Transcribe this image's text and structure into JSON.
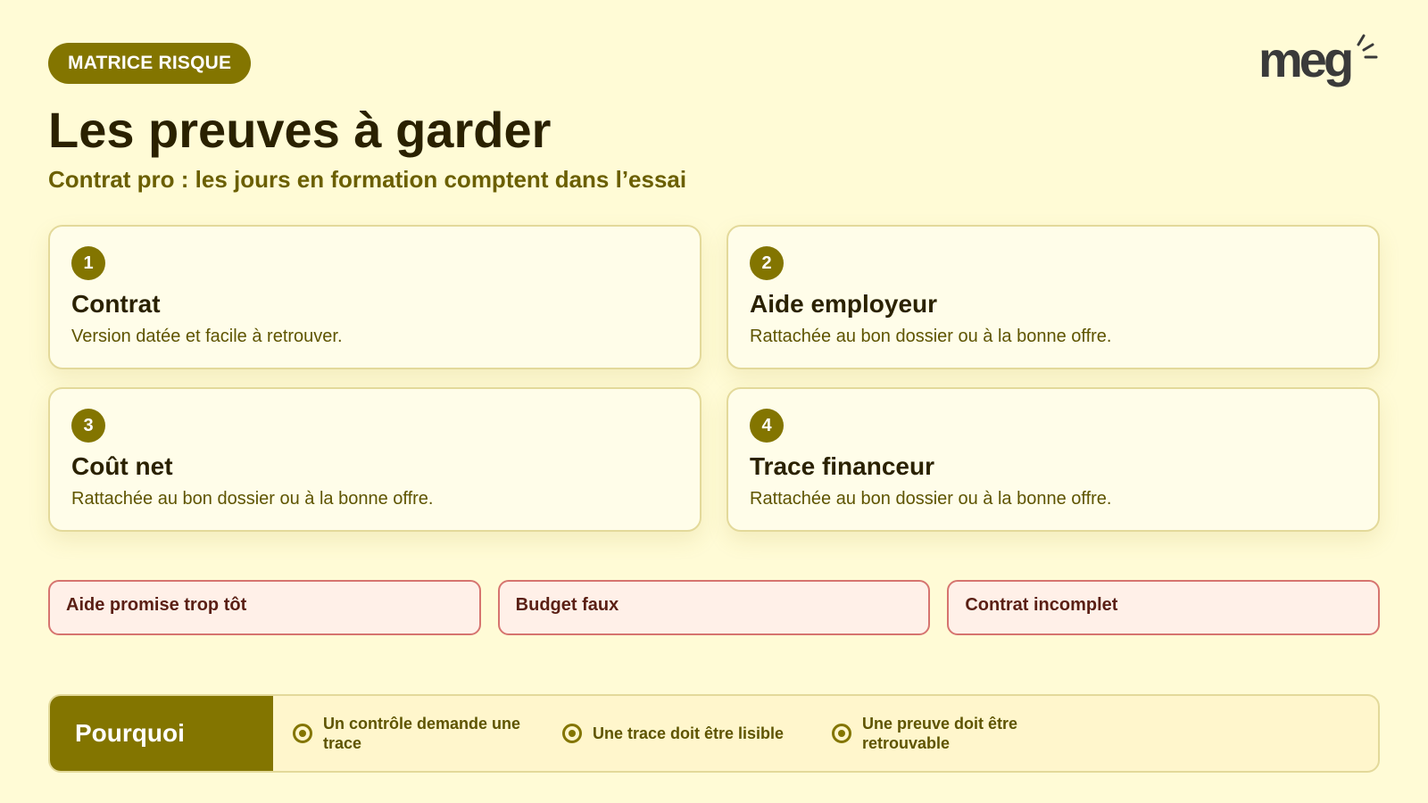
{
  "badge": "MATRICE RISQUE",
  "logo_text": "meg",
  "title": "Les preuves à garder",
  "subtitle": "Contrat pro : les jours en formation comptent dans l’essai",
  "cards": [
    {
      "number": "1",
      "title": "Contrat",
      "description": "Version datée et facile à retrouver."
    },
    {
      "number": "2",
      "title": "Aide employeur",
      "description": "Rattachée au bon dossier ou à la bonne offre."
    },
    {
      "number": "3",
      "title": "Coût net",
      "description": "Rattachée au bon dossier ou à la bonne offre."
    },
    {
      "number": "4",
      "title": "Trace financeur",
      "description": "Rattachée au bon dossier ou à la bonne offre."
    }
  ],
  "risks": [
    "Aide promise trop tôt",
    "Budget faux",
    "Contrat incomplet"
  ],
  "why": {
    "label": "Pourquoi",
    "items": [
      "Un contrôle demande une trace",
      "Une trace doit être lisible",
      "Une preuve doit être retrouvable"
    ],
    "icon": "radio-target-icon"
  },
  "colors": {
    "background": "#fffbd6",
    "accent": "#837500",
    "risk_border": "#d6746f",
    "risk_fill": "#fff0e8"
  }
}
